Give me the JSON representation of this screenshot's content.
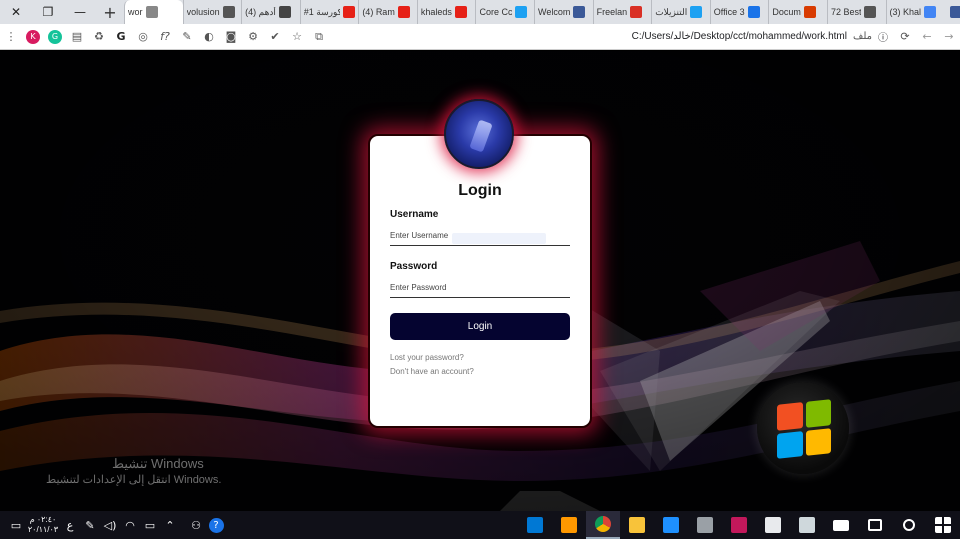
{
  "browser": {
    "window_controls": {
      "close": "✕",
      "restore": "❐",
      "minimize": "—"
    },
    "new_tab": "+",
    "tabs": [
      {
        "title": "wor",
        "fav_color": "#888888",
        "active": true
      },
      {
        "title": "volusion",
        "fav_color": "#555555"
      },
      {
        "title": "(4) أدهم",
        "fav_color": "#444444"
      },
      {
        "title": "#1 كورسة",
        "fav_color": "#e62117"
      },
      {
        "title": "(4) Ram",
        "fav_color": "#e62117"
      },
      {
        "title": "khaleds",
        "fav_color": "#e62117"
      },
      {
        "title": "Core Cc",
        "fav_color": "#1da1f2"
      },
      {
        "title": "Welcom",
        "fav_color": "#3b5998"
      },
      {
        "title": "Freelan",
        "fav_color": "#d93025"
      },
      {
        "title": "التنزيلات",
        "fav_color": "#1da1f2"
      },
      {
        "title": "Office 3",
        "fav_color": "#1a73e8"
      },
      {
        "title": "Docum",
        "fav_color": "#d83b01"
      },
      {
        "title": "72 Best",
        "fav_color": "#555555"
      },
      {
        "title": "(3) Khal",
        "fav_color": "#4285f4"
      }
    ],
    "last_tab_fav_color": "#3b5998",
    "address": {
      "url": "C:/Users/خالد/Desktop/cct/mohammed/work.html",
      "scheme_label": "ملف",
      "info_icon": "ⓘ"
    },
    "nav": {
      "reload": "⟳",
      "back": "←",
      "forward": "→"
    },
    "extensions": {
      "menu": "⋮",
      "k_badge": "K",
      "g_badge": "G",
      "fx": "f?",
      "star": "☆"
    }
  },
  "login": {
    "title": "Login",
    "username_label": "Username",
    "username_placeholder": "Enter Username",
    "password_label": "Password",
    "password_placeholder": "Enter Password",
    "submit": "Login",
    "lost_password": "Lost your password?",
    "no_account": "Don't have an account?"
  },
  "watermark": {
    "line1": "تنشيط Windows",
    "line2": "انتقل إلى الإعدادات لتنشيط Windows."
  },
  "taskbar": {
    "time": "٠٢:٤٠ م",
    "date": "٢٠/١١/٠٣",
    "lang": "ع",
    "apps": [
      {
        "name": "vscode",
        "color": "#0078d4",
        "active": false
      },
      {
        "name": "sublime",
        "color": "#ff9800",
        "active": false
      },
      {
        "name": "chrome",
        "color": "#e8eaed",
        "active": true
      },
      {
        "name": "explorer",
        "color": "#f8c33a",
        "active": false
      },
      {
        "name": "edge",
        "color": "#1e90ff",
        "active": false
      },
      {
        "name": "paint",
        "color": "#9aa0a6",
        "active": false
      },
      {
        "name": "photos",
        "color": "#c2185b",
        "active": false
      },
      {
        "name": "store",
        "color": "#e8eaed",
        "active": false
      },
      {
        "name": "people",
        "color": "#cfd8dc",
        "active": false
      },
      {
        "name": "mail",
        "color": "#ffffff",
        "active": false
      },
      {
        "name": "task-view",
        "color": "#ffffff",
        "active": false
      },
      {
        "name": "search",
        "color": "#ffffff",
        "active": false
      },
      {
        "name": "start",
        "color": "#ffffff",
        "active": false
      }
    ]
  },
  "colors": {
    "accent_glow": "#dc143c",
    "button_bg": "#050430"
  }
}
